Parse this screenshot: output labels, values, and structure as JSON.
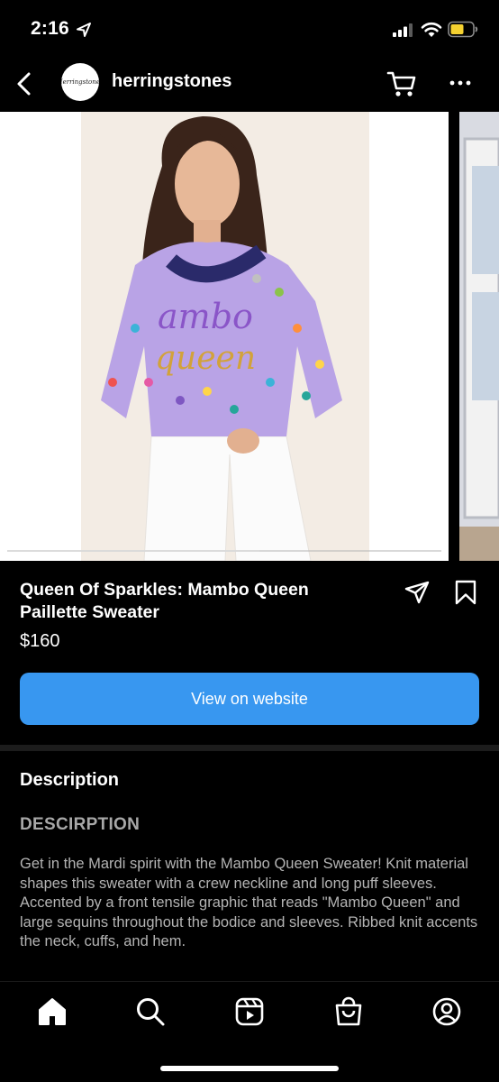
{
  "status_bar": {
    "time": "2:16",
    "icons": [
      "location-arrow-icon",
      "cellular-signal-icon",
      "wifi-icon",
      "battery-icon"
    ],
    "battery_color": "#f5d130"
  },
  "header": {
    "shop_name": "herringstones",
    "avatar_text": "Herringstones",
    "icons": [
      "back-icon",
      "shopping-cart-icon",
      "more-options-icon"
    ]
  },
  "carousel": {
    "progress_fraction": 0.58,
    "image_description_hidden": true
  },
  "product": {
    "title": "Queen Of Sparkles: Mambo Queen Paillette Sweater",
    "price": "$160",
    "actions": [
      "share-icon",
      "bookmark-icon"
    ]
  },
  "cta": {
    "label": "View on website",
    "color": "#3897f0"
  },
  "description": {
    "heading": "Description",
    "subheading": "DESCIRPTION",
    "body": "Get in the Mardi spirit with the Mambo Queen Sweater! Knit material shapes this sweater with a crew neckline and long puff sleeves. Accented by a front tensile graphic that reads \"Mambo Queen\" and large sequins throughout the bodice and sleeves. Ribbed knit accents the neck, cuffs, and hem."
  },
  "bottom_nav": {
    "items": [
      "home-icon",
      "search-icon",
      "reels-icon",
      "shop-icon",
      "profile-icon"
    ],
    "active": "home-icon"
  }
}
